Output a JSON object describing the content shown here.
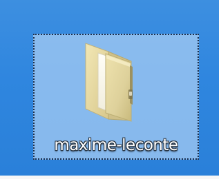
{
  "desktop_item": {
    "label": "maxime-leconte",
    "icon": "folder-icon",
    "selected": true
  },
  "colors": {
    "desktop_background": "#2f86df",
    "selection_fill": "#aacef4",
    "selection_border": "#1c2f4c",
    "label_text": "#ffffff",
    "folder_body": "#e4d7a2",
    "folder_shadow": "#b9ab72"
  }
}
